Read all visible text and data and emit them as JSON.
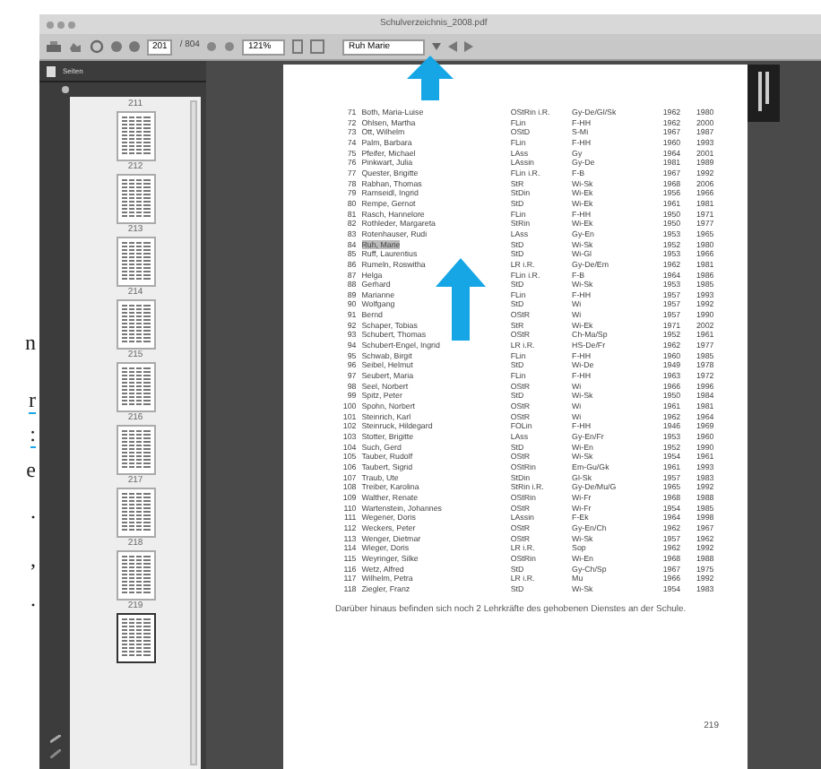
{
  "window": {
    "title": "Schulverzeichnis_2008.pdf"
  },
  "toolbar": {
    "page_field": "201",
    "page_count": "/ 804",
    "zoom_field": "121%",
    "search_field": "Ruh Marie"
  },
  "sidebar": {
    "title": "Seiten",
    "thumbnails": [
      {
        "label": "211",
        "selected": false
      },
      {
        "label": "212",
        "selected": false
      },
      {
        "label": "213",
        "selected": false
      },
      {
        "label": "214",
        "selected": false
      },
      {
        "label": "215",
        "selected": false
      },
      {
        "label": "216",
        "selected": false
      },
      {
        "label": "217",
        "selected": false
      },
      {
        "label": "218",
        "selected": false
      },
      {
        "label": "219",
        "selected": true
      }
    ]
  },
  "margin_text": [
    {
      "text": "n",
      "linked": false
    },
    {
      "text": "r",
      "linked": true
    },
    {
      "text": ":",
      "linked": true
    },
    {
      "text": "e",
      "linked": false
    },
    {
      "text": ".",
      "linked": false
    },
    {
      "text": ",",
      "linked": false
    },
    {
      "text": ".",
      "linked": false
    }
  ],
  "page": {
    "rows": [
      [
        "71",
        "Both, Maria-Luise",
        "OStRin i.R.",
        "Gy-De/Gl/Sk",
        "1962",
        "1980",
        false
      ],
      [
        "72",
        "Ohlsen, Martha",
        "FLin",
        "F-HH",
        "1962",
        "2000",
        false
      ],
      [
        "73",
        "Ott, Wilhelm",
        "OStD",
        "S-Mi",
        "1967",
        "1987",
        false
      ],
      [
        "74",
        "Palm, Barbara",
        "FLin",
        "F-HH",
        "1960",
        "1993",
        false
      ],
      [
        "75",
        "Pfeifer, Michael",
        "LAss",
        "Gy",
        "1964",
        "2001",
        false
      ],
      [
        "76",
        "Pinkwart, Julia",
        "LAssin",
        "Gy-De",
        "1981",
        "1989",
        false
      ],
      [
        "77",
        "Quester, Brigitte",
        "FLin i.R.",
        "F-B",
        "1967",
        "1992",
        false
      ],
      [
        "78",
        "Rabhan, Thomas",
        "StR",
        "Wi-Sk",
        "1968",
        "2006",
        false
      ],
      [
        "79",
        "Ramseidl, Ingrid",
        "StDin",
        "Wi-Ek",
        "1956",
        "1966",
        false
      ],
      [
        "80",
        "Rempe, Gernot",
        "StD",
        "Wi-Ek",
        "1961",
        "1981",
        false
      ],
      [
        "81",
        "Rasch, Hannelore",
        "FLin",
        "F-HH",
        "1950",
        "1971",
        false
      ],
      [
        "82",
        "Rothleder, Margareta",
        "StRin",
        "Wi-Ek",
        "1950",
        "1977",
        false
      ],
      [
        "83",
        "Rotenhauser, Rudi",
        "LAss",
        "Gy-En",
        "1953",
        "1965",
        false
      ],
      [
        "84",
        "Ruh, Marie",
        "StD",
        "Wi-Sk",
        "1952",
        "1980",
        true
      ],
      [
        "85",
        "Ruff, Laurentius",
        "StD",
        "Wi-Gl",
        "1953",
        "1966",
        false
      ],
      [
        "86",
        "Rumeln, Roswitha",
        "LR i.R.",
        "Gy-De/Em",
        "1962",
        "1981",
        false
      ],
      [
        "87",
        "Helga",
        "FLin i.R.",
        "F-B",
        "1964",
        "1986",
        false
      ],
      [
        "88",
        "Gerhard",
        "StD",
        "Wi-Sk",
        "1953",
        "1985",
        false
      ],
      [
        "89",
        "Marianne",
        "FLin",
        "F-HH",
        "1957",
        "1993",
        false
      ],
      [
        "90",
        "Wolfgang",
        "StD",
        "Wi",
        "1957",
        "1992",
        false
      ],
      [
        "91",
        "Bernd",
        "OStR",
        "Wi",
        "1957",
        "1990",
        false
      ],
      [
        "92",
        "Schaper, Tobias",
        "StR",
        "Wi-Ek",
        "1971",
        "2002",
        false
      ],
      [
        "93",
        "Schubert, Thomas",
        "OStR",
        "Ch-Ma/Sp",
        "1952",
        "1961",
        false
      ],
      [
        "94",
        "Schubert-Engel, Ingrid",
        "LR i.R.",
        "HS-De/Fr",
        "1962",
        "1977",
        false
      ],
      [
        "95",
        "Schwab, Birgit",
        "FLin",
        "F-HH",
        "1960",
        "1985",
        false
      ],
      [
        "96",
        "Seibel, Helmut",
        "StD",
        "Wi-De",
        "1949",
        "1978",
        false
      ],
      [
        "97",
        "Seubert, Maria",
        "FLin",
        "F-HH",
        "1963",
        "1972",
        false
      ],
      [
        "98",
        "Seel, Norbert",
        "OStR",
        "Wi",
        "1966",
        "1996",
        false
      ],
      [
        "99",
        "Spitz, Peter",
        "StD",
        "Wi-Sk",
        "1950",
        "1984",
        false
      ],
      [
        "100",
        "Spohn, Norbert",
        "OStR",
        "Wi",
        "1961",
        "1981",
        false
      ],
      [
        "101",
        "Steinrich, Karl",
        "OStR",
        "Wi",
        "1962",
        "1964",
        false
      ],
      [
        "102",
        "Steinruck, Hildegard",
        "FOLin",
        "F-HH",
        "1946",
        "1969",
        false
      ],
      [
        "103",
        "Stotter, Brigitte",
        "LAss",
        "Gy-En/Fr",
        "1953",
        "1960",
        false
      ],
      [
        "104",
        "Such, Gerd",
        "StD",
        "Wi-En",
        "1952",
        "1990",
        false
      ],
      [
        "105",
        "Tauber, Rudolf",
        "OStR",
        "Wi-Sk",
        "1954",
        "1961",
        false
      ],
      [
        "106",
        "Taubert, Sigrid",
        "OStRin",
        "Em-Gu/Gk",
        "1961",
        "1993",
        false
      ],
      [
        "107",
        "Traub, Ute",
        "StDin",
        "Gl-Sk",
        "1957",
        "1983",
        false
      ],
      [
        "108",
        "Treiber, Karolina",
        "StRin i.R.",
        "Gy-De/Mu/G",
        "1965",
        "1992",
        false
      ],
      [
        "109",
        "Walther, Renate",
        "OStRin",
        "Wi-Fr",
        "1968",
        "1988",
        false
      ],
      [
        "110",
        "Wartenstein, Johannes",
        "OStR",
        "Wi-Fr",
        "1954",
        "1985",
        false
      ],
      [
        "111",
        "Wegener, Doris",
        "LAssin",
        "F-Ek",
        "1964",
        "1998",
        false
      ],
      [
        "112",
        "Weckers, Peter",
        "OStR",
        "Gy-En/Ch",
        "1962",
        "1967",
        false
      ],
      [
        "113",
        "Wenger, Dietmar",
        "OStR",
        "Wi-Sk",
        "1957",
        "1962",
        false
      ],
      [
        "114",
        "Wieger, Doris",
        "LR i.R.",
        "Sop",
        "1962",
        "1992",
        false
      ],
      [
        "115",
        "Weyringer, Silke",
        "OStRin",
        "Wi-En",
        "1968",
        "1988",
        false
      ],
      [
        "116",
        "Wetz, Alfred",
        "StD",
        "Gy-Ch/Sp",
        "1967",
        "1975",
        false
      ],
      [
        "117",
        "Wilhelm, Petra",
        "LR i.R.",
        "Mu",
        "1966",
        "1992",
        false
      ],
      [
        "118",
        "Ziegler, Franz",
        "StD",
        "Wi-Sk",
        "1954",
        "1983",
        false
      ]
    ],
    "footnote": "Darüber hinaus befinden sich noch 2 Lehrkräfte des gehobenen Dienstes an der Schule.",
    "page_number": "219"
  }
}
